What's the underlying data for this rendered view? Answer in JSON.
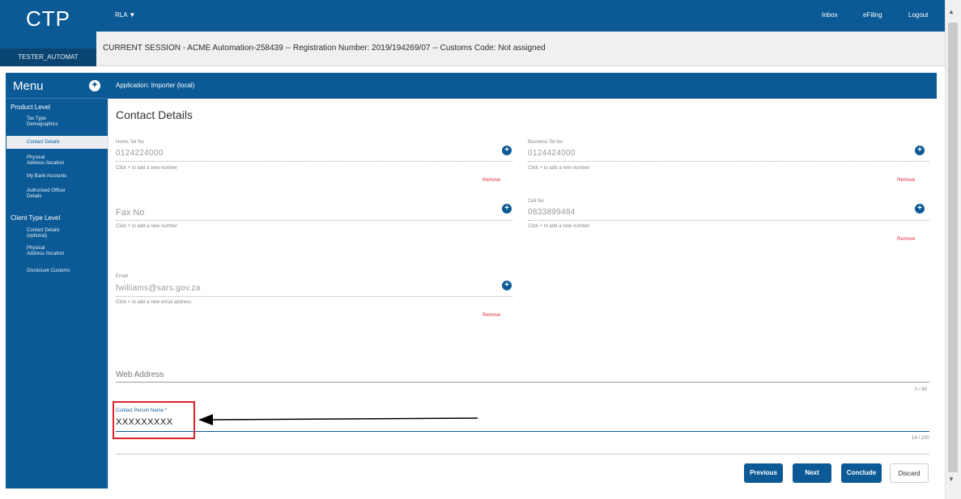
{
  "app": {
    "logo": "CTP",
    "user": "TESTER_AUTOMAT",
    "rla": "RLA ▼"
  },
  "topnav": {
    "inbox": "Inbox",
    "efiling": "eFiling",
    "logout": "Logout"
  },
  "session": "CURRENT SESSION - ACME Automation-258439 -- Registration Number: 2019/194269/07 -- Customs Code: Not assigned",
  "menu": {
    "title": "Menu",
    "product_level": "Product Level",
    "items_product": [
      {
        "label": "Tax Type\nDemographics"
      },
      {
        "label": "Contact Details"
      },
      {
        "label": "Physical\nAddress /location"
      },
      {
        "label": "My Bank Accounts"
      },
      {
        "label": "Authorised Officer\nDetails"
      }
    ],
    "client_level": "Client Type Level",
    "items_client": [
      {
        "label": "Contact Details\n(optional)"
      },
      {
        "label": "Physical\nAddress /location"
      },
      {
        "label": "Disclosure Customs"
      }
    ]
  },
  "application": "Application: Importer (local)",
  "page_title": "Contact Details",
  "fields": {
    "home_tel": {
      "label": "Home Tel No",
      "value": "0124224000",
      "hint": "Click + to add a new number",
      "remove": "Remove"
    },
    "business_tel": {
      "label": "Business Tel No",
      "value": "0124424000",
      "hint": "Click + to add a new number",
      "remove": "Remove"
    },
    "fax": {
      "label": "Fax No",
      "hint": "Click + to add a new number"
    },
    "cell": {
      "label": "Cell No",
      "value": "0833899484",
      "hint": "Click + to add a new number",
      "remove": "Remove"
    },
    "email": {
      "label": "Email",
      "value": "fwilliams@sars.gov.za",
      "hint": "Click + to add a new email address",
      "remove": "Remove"
    },
    "web": {
      "label": "Web Address",
      "count": "0 / 60"
    },
    "contact_person": {
      "label": "Contact Person Name *",
      "value": "XXXXXXXXX",
      "count": "14 / 100"
    }
  },
  "buttons": {
    "previous": "Previous",
    "next": "Next",
    "conclude": "Conclude",
    "discard": "Discard"
  },
  "icons": {
    "plus": "plus-circle-icon",
    "menu": "menu-toggle-icon"
  }
}
